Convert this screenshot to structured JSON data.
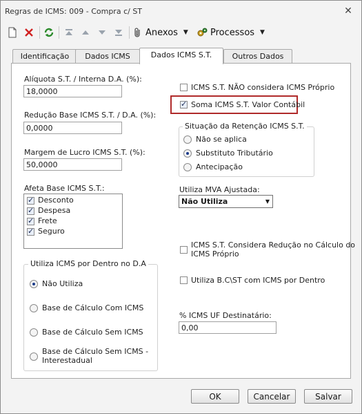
{
  "window": {
    "title": "Regras de ICMS: 009 - Compra c/ ST"
  },
  "toolbar": {
    "anexos": "Anexos",
    "processos": "Processos"
  },
  "tabs": [
    "Identificação",
    "Dados ICMS",
    "Dados ICMS S.T.",
    "Outros Dados"
  ],
  "left": {
    "aliquota_label": "Alíquota S.T. / Interna D.A. (%):",
    "aliquota_value": "18,0000",
    "reducao_label": "Redução Base ICMS S.T. / D.A. (%):",
    "reducao_value": "0,0000",
    "margem_label": "Margem de Lucro ICMS S.T. (%):",
    "margem_value": "50,0000",
    "afeta_label": "Afeta Base ICMS S.T.:",
    "afeta_items": [
      "Desconto",
      "Despesa",
      "Frete",
      "Seguro"
    ]
  },
  "dentro": {
    "title": "Utiliza ICMS por Dentro no D.A",
    "options": [
      "Não Utiliza",
      "Base de Cálculo Com ICMS",
      "Base de Cálculo Sem ICMS",
      "Base de Cálculo Sem ICMS -",
      "Interestadual"
    ]
  },
  "right": {
    "chk_nao_considera": "ICMS S.T. NÃO considera ICMS Próprio",
    "chk_soma": "Soma ICMS S.T. Valor Contábil",
    "situacao_title": "Situação da Retenção ICMS S.T.",
    "situacao_options": [
      "Não se aplica",
      "Substituto Tributário",
      "Antecipação"
    ],
    "mva_label": "Utiliza MVA Ajustada:",
    "mva_value": "Não Utiliza",
    "chk_reducao_line1": "ICMS S.T. Considera Redução no Cálculo do",
    "chk_reducao_line2": "ICMS Próprio",
    "chk_bc_dentro": "Utiliza B.C\\ST com ICMS por Dentro",
    "uf_label": "% ICMS UF Destinatário:",
    "uf_value": "0,00"
  },
  "buttons": {
    "ok": "OK",
    "cancel": "Cancelar",
    "save": "Salvar"
  }
}
